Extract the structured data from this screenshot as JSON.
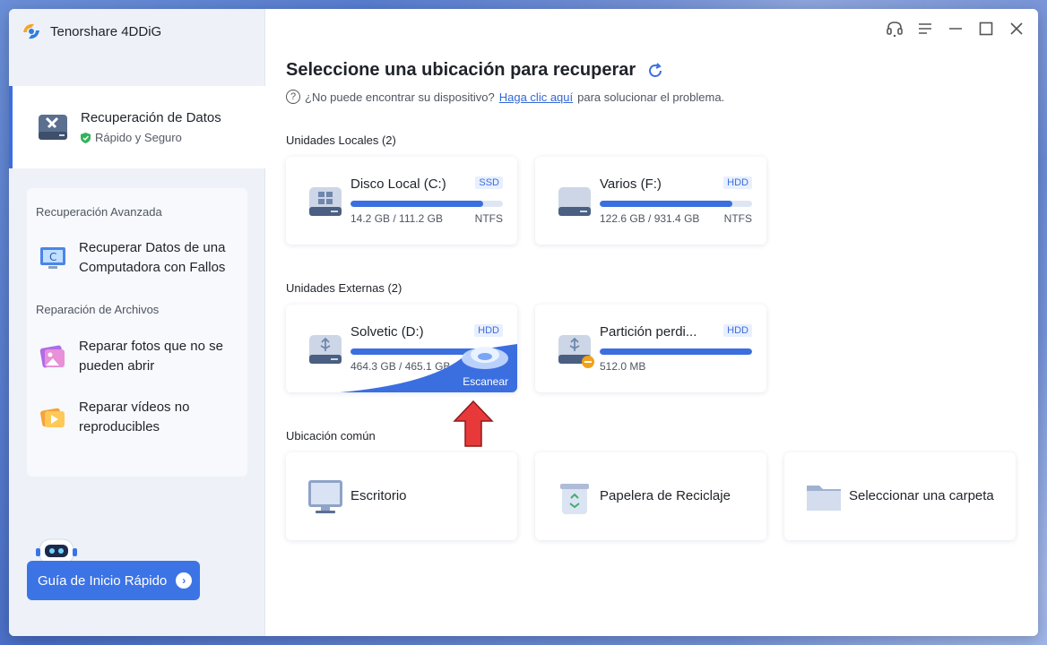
{
  "app": {
    "title": "Tenorshare 4DDiG"
  },
  "sidebar": {
    "active": {
      "title": "Recuperación de Datos",
      "subtitle": "Rápido y Seguro"
    },
    "sections": [
      {
        "heading": "Recuperación Avanzada",
        "items": [
          {
            "label": "Recuperar Datos de una Computadora con Fallos",
            "icon": "crashed-computer-icon"
          }
        ]
      },
      {
        "heading": "Reparación de Archivos",
        "items": [
          {
            "label": "Reparar fotos que no se pueden abrir",
            "icon": "photo-repair-icon"
          },
          {
            "label": "Reparar vídeos no reproducibles",
            "icon": "video-repair-icon"
          }
        ]
      }
    ],
    "guide_button": "Guía de Inicio Rápido"
  },
  "main": {
    "title": "Seleccione una ubicación para recuperar",
    "hint_prefix": "¿No puede encontrar su dispositivo?",
    "hint_link": "Haga clic aquí",
    "hint_suffix": "para solucionar el problema.",
    "local_heading": "Unidades Locales (2)",
    "local_drives": [
      {
        "name": "Disco Local (C:)",
        "type": "SSD",
        "size": "14.2 GB / 111.2 GB",
        "fs": "NTFS",
        "used_fraction": 0.87
      },
      {
        "name": "Varios (F:)",
        "type": "HDD",
        "size": "122.6 GB / 931.4 GB",
        "fs": "NTFS",
        "used_fraction": 0.87
      }
    ],
    "external_heading": "Unidades Externas (2)",
    "external_drives": [
      {
        "name": "Solvetic (D:)",
        "type": "HDD",
        "size": "464.3 GB / 465.1 GB",
        "fs": "",
        "used_fraction": 0.99,
        "scan_label": "Escanear"
      },
      {
        "name": "Partición perdi...",
        "type": "HDD",
        "size": "512.0 MB",
        "fs": "",
        "used_fraction": 1.0
      }
    ],
    "common_heading": "Ubicación común",
    "common_locations": [
      {
        "name": "Escritorio",
        "icon": "desktop-icon"
      },
      {
        "name": "Papelera de Reciclaje",
        "icon": "recycle-bin-icon"
      },
      {
        "name": "Seleccionar una carpeta",
        "icon": "folder-icon"
      }
    ]
  },
  "colors": {
    "accent": "#3b6fe0",
    "sidebar_bg": "#eef2f8",
    "annotation_arrow": "#e8393a"
  }
}
